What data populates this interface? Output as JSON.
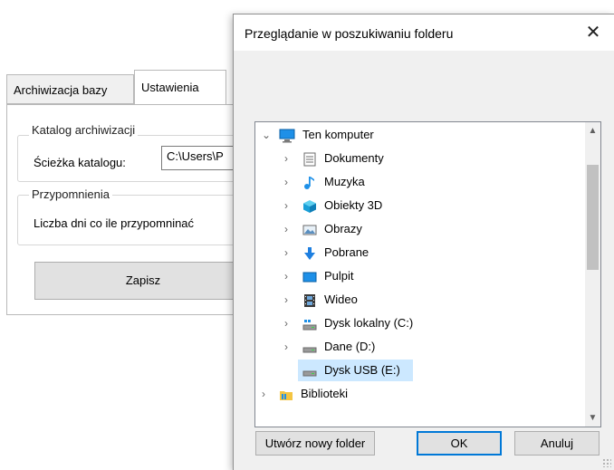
{
  "app": {
    "tabs": [
      {
        "label": "Archiwizacja bazy"
      },
      {
        "label": "Ustawienia"
      }
    ],
    "archive_group": {
      "title": "Katalog archiwizacji",
      "path_label": "Ścieżka katalogu:",
      "path_value": "C:\\Users\\P"
    },
    "reminder_group": {
      "title": "Przypomnienia",
      "days_label": "Liczba dni co ile przypomninać"
    },
    "save_label": "Zapisz"
  },
  "dialog": {
    "title": "Przeglądanie w poszukiwaniu folderu",
    "close_glyph": "✕",
    "tree": [
      {
        "label": "Ten komputer",
        "icon": "computer-icon",
        "level": 0,
        "expanded": true
      },
      {
        "label": "Dokumenty",
        "icon": "documents-icon",
        "level": 1
      },
      {
        "label": "Muzyka",
        "icon": "music-icon",
        "level": 1
      },
      {
        "label": "Obiekty 3D",
        "icon": "objects-3d-icon",
        "level": 1
      },
      {
        "label": "Obrazy",
        "icon": "pictures-icon",
        "level": 1
      },
      {
        "label": "Pobrane",
        "icon": "downloads-icon",
        "level": 1
      },
      {
        "label": "Pulpit",
        "icon": "desktop-icon",
        "level": 1
      },
      {
        "label": "Wideo",
        "icon": "video-icon",
        "level": 1
      },
      {
        "label": "Dysk lokalny (C:)",
        "icon": "local-disk-icon",
        "level": 1
      },
      {
        "label": "Dane (D:)",
        "icon": "drive-icon",
        "level": 1
      },
      {
        "label": "Dysk USB (E:)",
        "icon": "usb-drive-icon",
        "level": 1,
        "selected": true
      },
      {
        "label": "Biblioteki",
        "icon": "libraries-icon",
        "level": 0
      }
    ],
    "buttons": {
      "new_folder": "Utwórz nowy folder",
      "ok": "OK",
      "cancel": "Anuluj"
    }
  },
  "colors": {
    "selection": "#cce8ff",
    "accent": "#0078d7",
    "dialog_bg": "#f0f0f0"
  }
}
